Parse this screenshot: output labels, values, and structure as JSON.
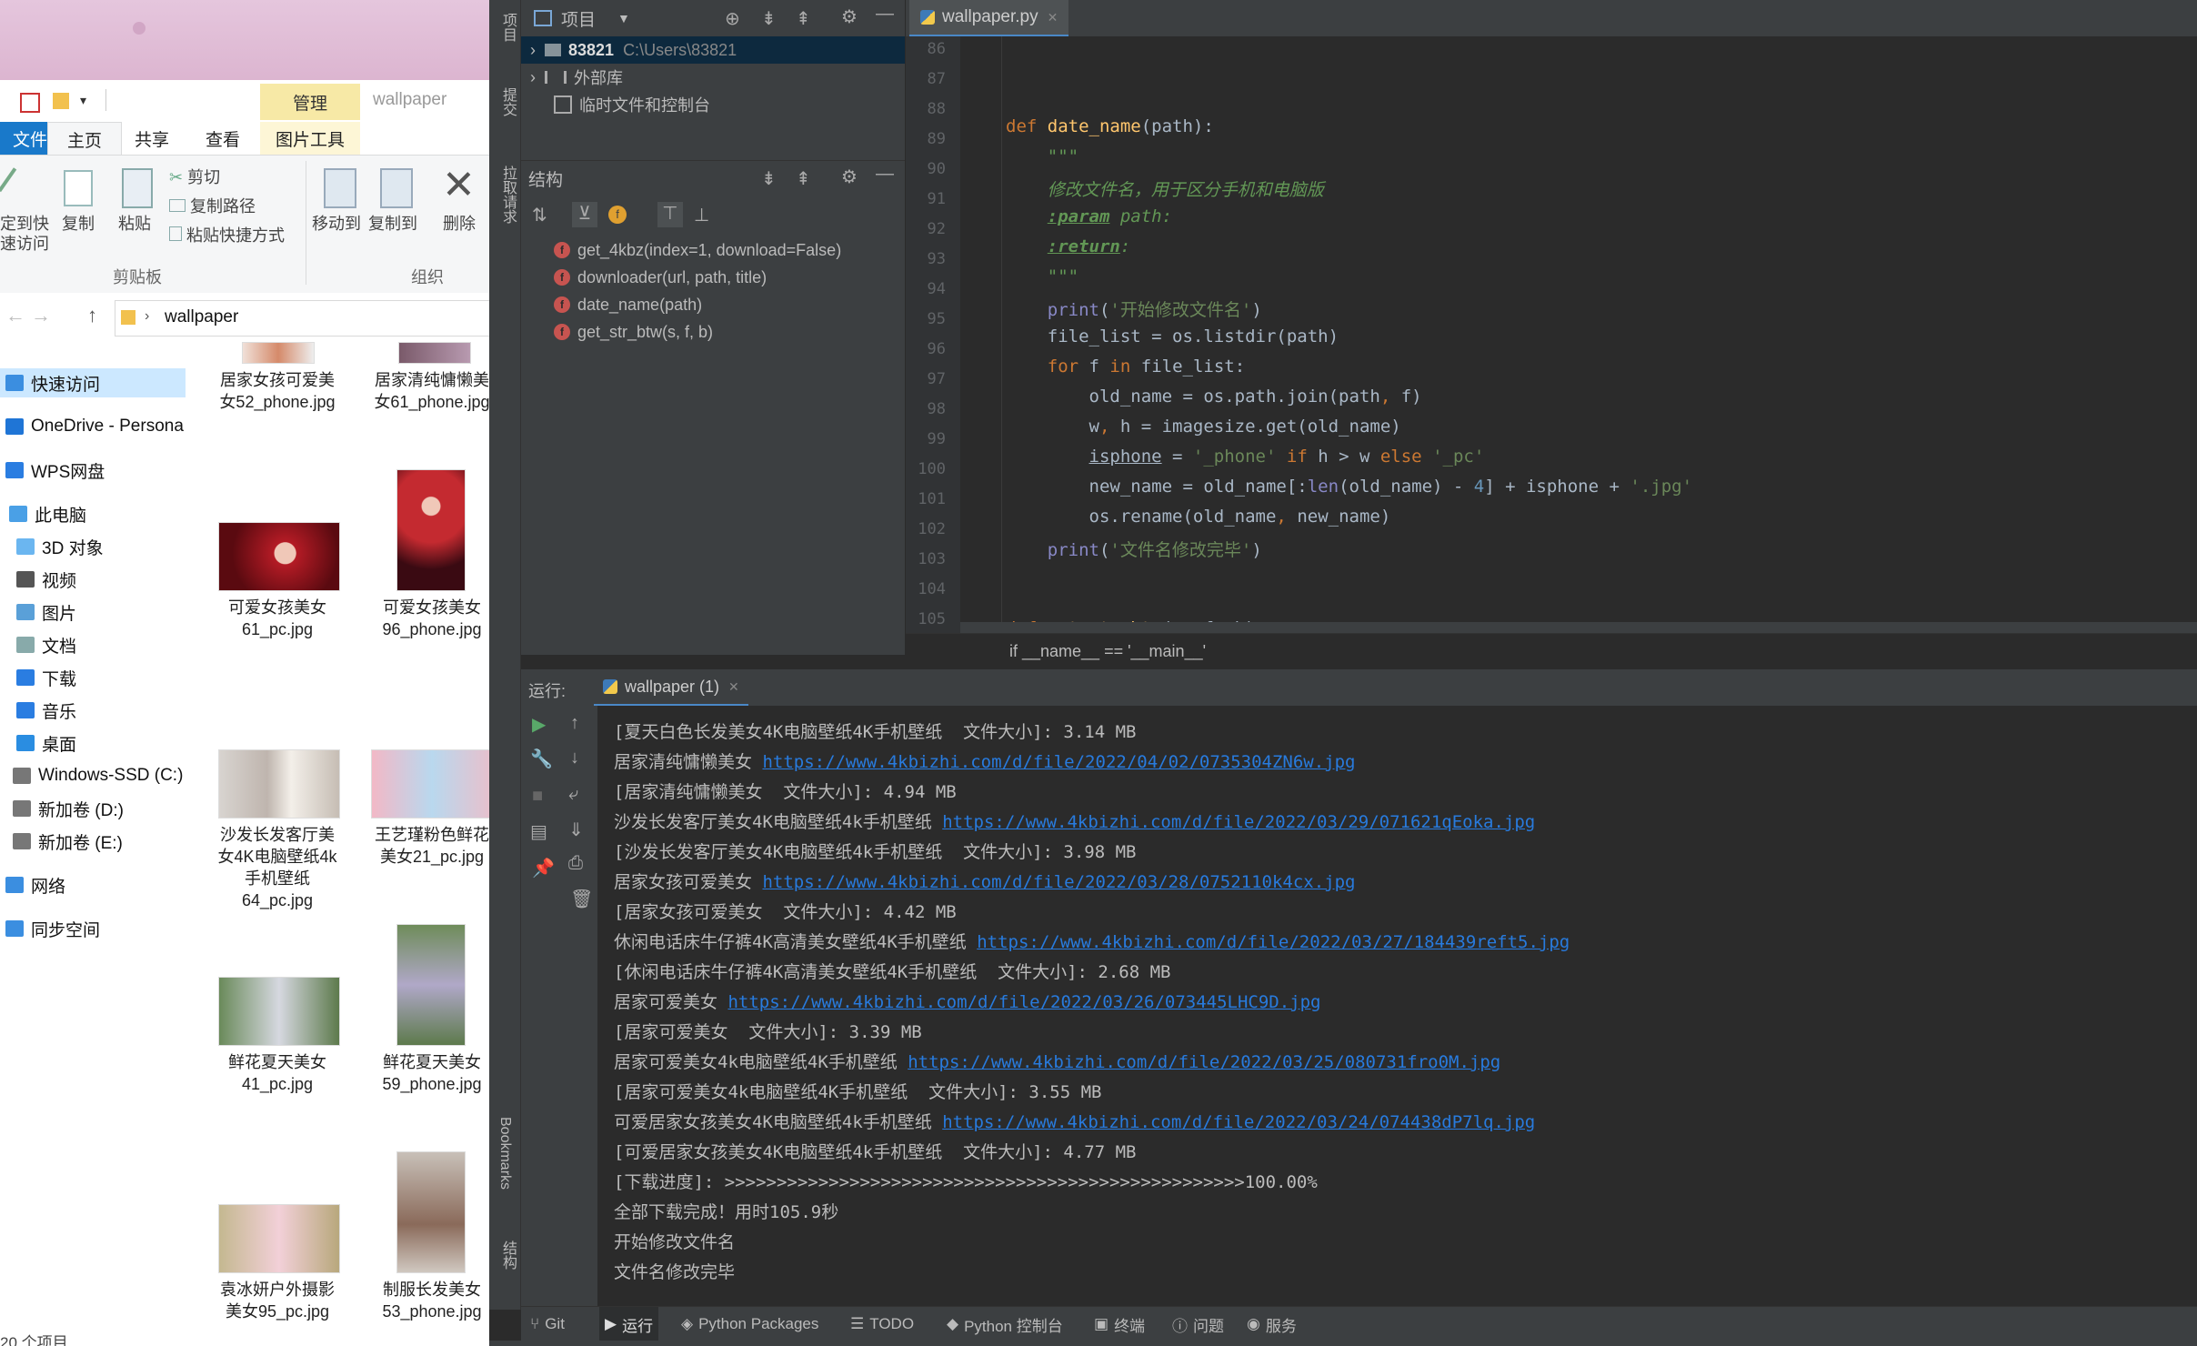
{
  "explorer": {
    "manage_tab": "管理",
    "window_title": "wallpaper",
    "ribbon_tabs": [
      "文件",
      "主页",
      "共享",
      "查看",
      "图片工具"
    ],
    "ribbon": {
      "pin_label": "定到快\n速访问",
      "copy_label": "复制",
      "paste_label": "粘贴",
      "cut_label": "剪切",
      "copy_path_label": "复制路径",
      "paste_shortcut_label": "粘贴快捷方式",
      "move_to_label": "移动到",
      "copy_to_label": "复制到",
      "delete_label": "删除",
      "group_clipboard": "剪贴板",
      "group_organize": "组织"
    },
    "address": "wallpaper",
    "nav_items": [
      {
        "label": "快速访问",
        "color": "#3b8ee0"
      },
      {
        "label": "OneDrive - Persona",
        "color": "#1f75d6"
      },
      {
        "label": "WPS网盘",
        "color": "#2a7de1"
      },
      {
        "label": "此电脑",
        "color": "#4aa0e6"
      },
      {
        "label": "3D 对象",
        "color": "#6bb6f0"
      },
      {
        "label": "视频",
        "color": "#555"
      },
      {
        "label": "图片",
        "color": "#5aa0d8"
      },
      {
        "label": "文档",
        "color": "#8aa"
      },
      {
        "label": "下载",
        "color": "#2a7de1"
      },
      {
        "label": "音乐",
        "color": "#2a7de1"
      },
      {
        "label": "桌面",
        "color": "#2a8de1"
      },
      {
        "label": "Windows-SSD (C:)",
        "color": "#777"
      },
      {
        "label": "新加卷 (D:)",
        "color": "#777"
      },
      {
        "label": "新加卷 (E:)",
        "color": "#777"
      },
      {
        "label": "网络",
        "color": "#3b8ee0"
      },
      {
        "label": "同步空间",
        "color": "#3b8ee0"
      }
    ],
    "files": [
      {
        "name": "居家女孩可爱美\n女52_phone.jpg"
      },
      {
        "name": "居家清纯慵懒美\n女61_phone.jpg"
      },
      {
        "name": "可爱女孩美女\n61_pc.jpg"
      },
      {
        "name": "可爱女孩美女\n96_phone.jpg"
      },
      {
        "name": "沙发长发客厅美\n女4K电脑壁纸4k\n手机壁纸\n64_pc.jpg"
      },
      {
        "name": "王艺瑾粉色鲜花\n美女21_pc.jpg"
      },
      {
        "name": "鲜花夏天美女\n41_pc.jpg"
      },
      {
        "name": "鲜花夏天美女\n59_phone.jpg"
      },
      {
        "name": "袁冰妍户外摄影\n美女95_pc.jpg"
      },
      {
        "name": "制服长发美女\n53_phone.jpg"
      }
    ],
    "item_count": "20 个项目"
  },
  "ide": {
    "left_strip": [
      "项目",
      "提交",
      "拉取请求",
      "Bookmarks",
      "结构"
    ],
    "project_panel": {
      "title": "项目",
      "root_name": "83821",
      "root_path": "C:\\Users\\83821",
      "external_libs": "外部库",
      "scratches": "临时文件和控制台"
    },
    "structure": {
      "title": "结构",
      "items": [
        "get_4kbz(index=1, download=False)",
        "downloader(url, path, title)",
        "date_name(path)",
        "get_str_btw(s, f, b)"
      ]
    },
    "editor_tab": "wallpaper.py",
    "line_numbers": [
      "86",
      "87",
      "88",
      "89",
      "90",
      "91",
      "92",
      "93",
      "94",
      "95",
      "96",
      "97",
      "98",
      "99",
      "100",
      "101",
      "102",
      "103",
      "104",
      "105"
    ],
    "breadcrumb": "if __name__ == '__main__'",
    "run": {
      "label": "运行:",
      "tab": "wallpaper (1)",
      "lines": [
        {
          "text": "[夏天白色长发美女4K电脑壁纸4K手机壁纸  文件大小]: 3.14 MB"
        },
        {
          "text": "居家清纯慵懒美女 ",
          "link": "https://www.4kbizhi.com/d/file/2022/04/02/0735304ZN6w.jpg"
        },
        {
          "text": "[居家清纯慵懒美女  文件大小]: 4.94 MB"
        },
        {
          "text": "沙发长发客厅美女4K电脑壁纸4k手机壁纸 ",
          "link": "https://www.4kbizhi.com/d/file/2022/03/29/071621qEoka.jpg"
        },
        {
          "text": "[沙发长发客厅美女4K电脑壁纸4k手机壁纸  文件大小]: 3.98 MB"
        },
        {
          "text": "居家女孩可爱美女 ",
          "link": "https://www.4kbizhi.com/d/file/2022/03/28/0752110k4cx.jpg"
        },
        {
          "text": "[居家女孩可爱美女  文件大小]: 4.42 MB"
        },
        {
          "text": "休闲电话床牛仔裤4K高清美女壁纸4K手机壁纸 ",
          "link": "https://www.4kbizhi.com/d/file/2022/03/27/184439reft5.jpg"
        },
        {
          "text": "[休闲电话床牛仔裤4K高清美女壁纸4K手机壁纸  文件大小]: 2.68 MB"
        },
        {
          "text": "居家可爱美女 ",
          "link": "https://www.4kbizhi.com/d/file/2022/03/26/073445LHC9D.jpg"
        },
        {
          "text": "[居家可爱美女  文件大小]: 3.39 MB"
        },
        {
          "text": "居家可爱美女4k电脑壁纸4K手机壁纸 ",
          "link": "https://www.4kbizhi.com/d/file/2022/03/25/080731fro0M.jpg"
        },
        {
          "text": "[居家可爱美女4k电脑壁纸4K手机壁纸  文件大小]: 3.55 MB"
        },
        {
          "text": "可爱居家女孩美女4K电脑壁纸4k手机壁纸 ",
          "link": "https://www.4kbizhi.com/d/file/2022/03/24/074438dP7lq.jpg"
        },
        {
          "text": "[可爱居家女孩美女4K电脑壁纸4k手机壁纸  文件大小]: 4.77 MB"
        },
        {
          "text": "[下载进度]: >>>>>>>>>>>>>>>>>>>>>>>>>>>>>>>>>>>>>>>>>>>>>>>>>>100.00%"
        },
        {
          "text": "全部下载完成！用时105.9秒"
        },
        {
          "text": "开始修改文件名"
        },
        {
          "text": "文件名修改完毕"
        }
      ]
    },
    "bottom_tabs": [
      "Git",
      "运行",
      "Python Packages",
      "TODO",
      "Python 控制台",
      "终端",
      "问题",
      "服务"
    ]
  }
}
